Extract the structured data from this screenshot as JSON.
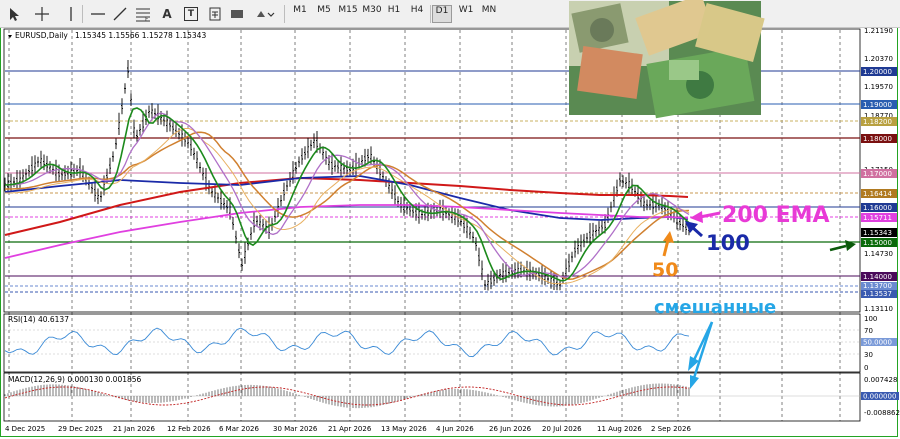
{
  "toolbar": {
    "tools": [
      "cursor-tool",
      "crosshair-tool",
      "vertical-line-tool",
      "horizontal-line-tool",
      "trendline-tool",
      "fibo-tool",
      "text-tool",
      "label-tool",
      "rectangle-tool",
      "shapes-dropdown"
    ],
    "text_tool_label": "A",
    "label_tool_label": "T",
    "timeframes": [
      "M1",
      "M5",
      "M15",
      "M30",
      "H1",
      "H4",
      "D1",
      "W1",
      "MN"
    ],
    "active_timeframe": "D1"
  },
  "header": {
    "symbol": "EURUSD,Daily",
    "ohlc": "1.15345 1.15566 1.15278 1.15343"
  },
  "price_axis": {
    "ticks": [
      "1.21190",
      "1.20370",
      "1.19570",
      "1.18770",
      "1.17150",
      "1.14730",
      "1.13110"
    ],
    "levels": [
      {
        "label": "1.20000",
        "color": "#1f3a93"
      },
      {
        "label": "1.19000",
        "color": "#2a5db0"
      },
      {
        "label": "1.18200",
        "color": "#b8a040"
      },
      {
        "label": "1.18000",
        "color": "#7a1010"
      },
      {
        "label": "1.17000",
        "color": "#d070a0"
      },
      {
        "label": "1.16414",
        "color": "#b07a20"
      },
      {
        "label": "1.16000",
        "color": "#1f3a93"
      },
      {
        "label": "1.15711",
        "color": "#e040e0"
      },
      {
        "label": "1.15343",
        "color": "#000000"
      },
      {
        "label": "1.15000",
        "color": "#0a6a0a"
      },
      {
        "label": "1.14000",
        "color": "#4a0a5a"
      },
      {
        "label": "1.13700",
        "color": "#6a8ad0"
      },
      {
        "label": "1.13537",
        "color": "#3a5ab0"
      }
    ]
  },
  "rsi": {
    "label": "RSI(14) 40.6137",
    "ticks": [
      "100",
      "70",
      "50.0000",
      "30",
      "0"
    ]
  },
  "macd": {
    "label": "MACD(12,26,9) 0.000130 0.001856",
    "ticks": [
      "0.007428",
      "0.000000",
      "-0.008862"
    ]
  },
  "time_axis": [
    "4 Dec 2025",
    "29 Dec 2025",
    "21 Jan 2026",
    "12 Feb 2026",
    "6 Mar 2026",
    "30 Mar 2026",
    "21 Apr 2026",
    "13 May 2026",
    "4 Jun 2026",
    "26 Jun 2026",
    "20 Jul 2026",
    "11 Aug 2026",
    "2 Sep 2026"
  ],
  "annotations": {
    "ema200": "200 EMA",
    "ema100": "100",
    "ema50": "50",
    "mixed": "смешанные"
  },
  "colors": {
    "frame": "#23a323",
    "ema200_text": "#e83ad6",
    "ema100_text": "#1a2aa8",
    "ema50_text": "#f08a1a",
    "mixed_text": "#26a6e6"
  }
}
